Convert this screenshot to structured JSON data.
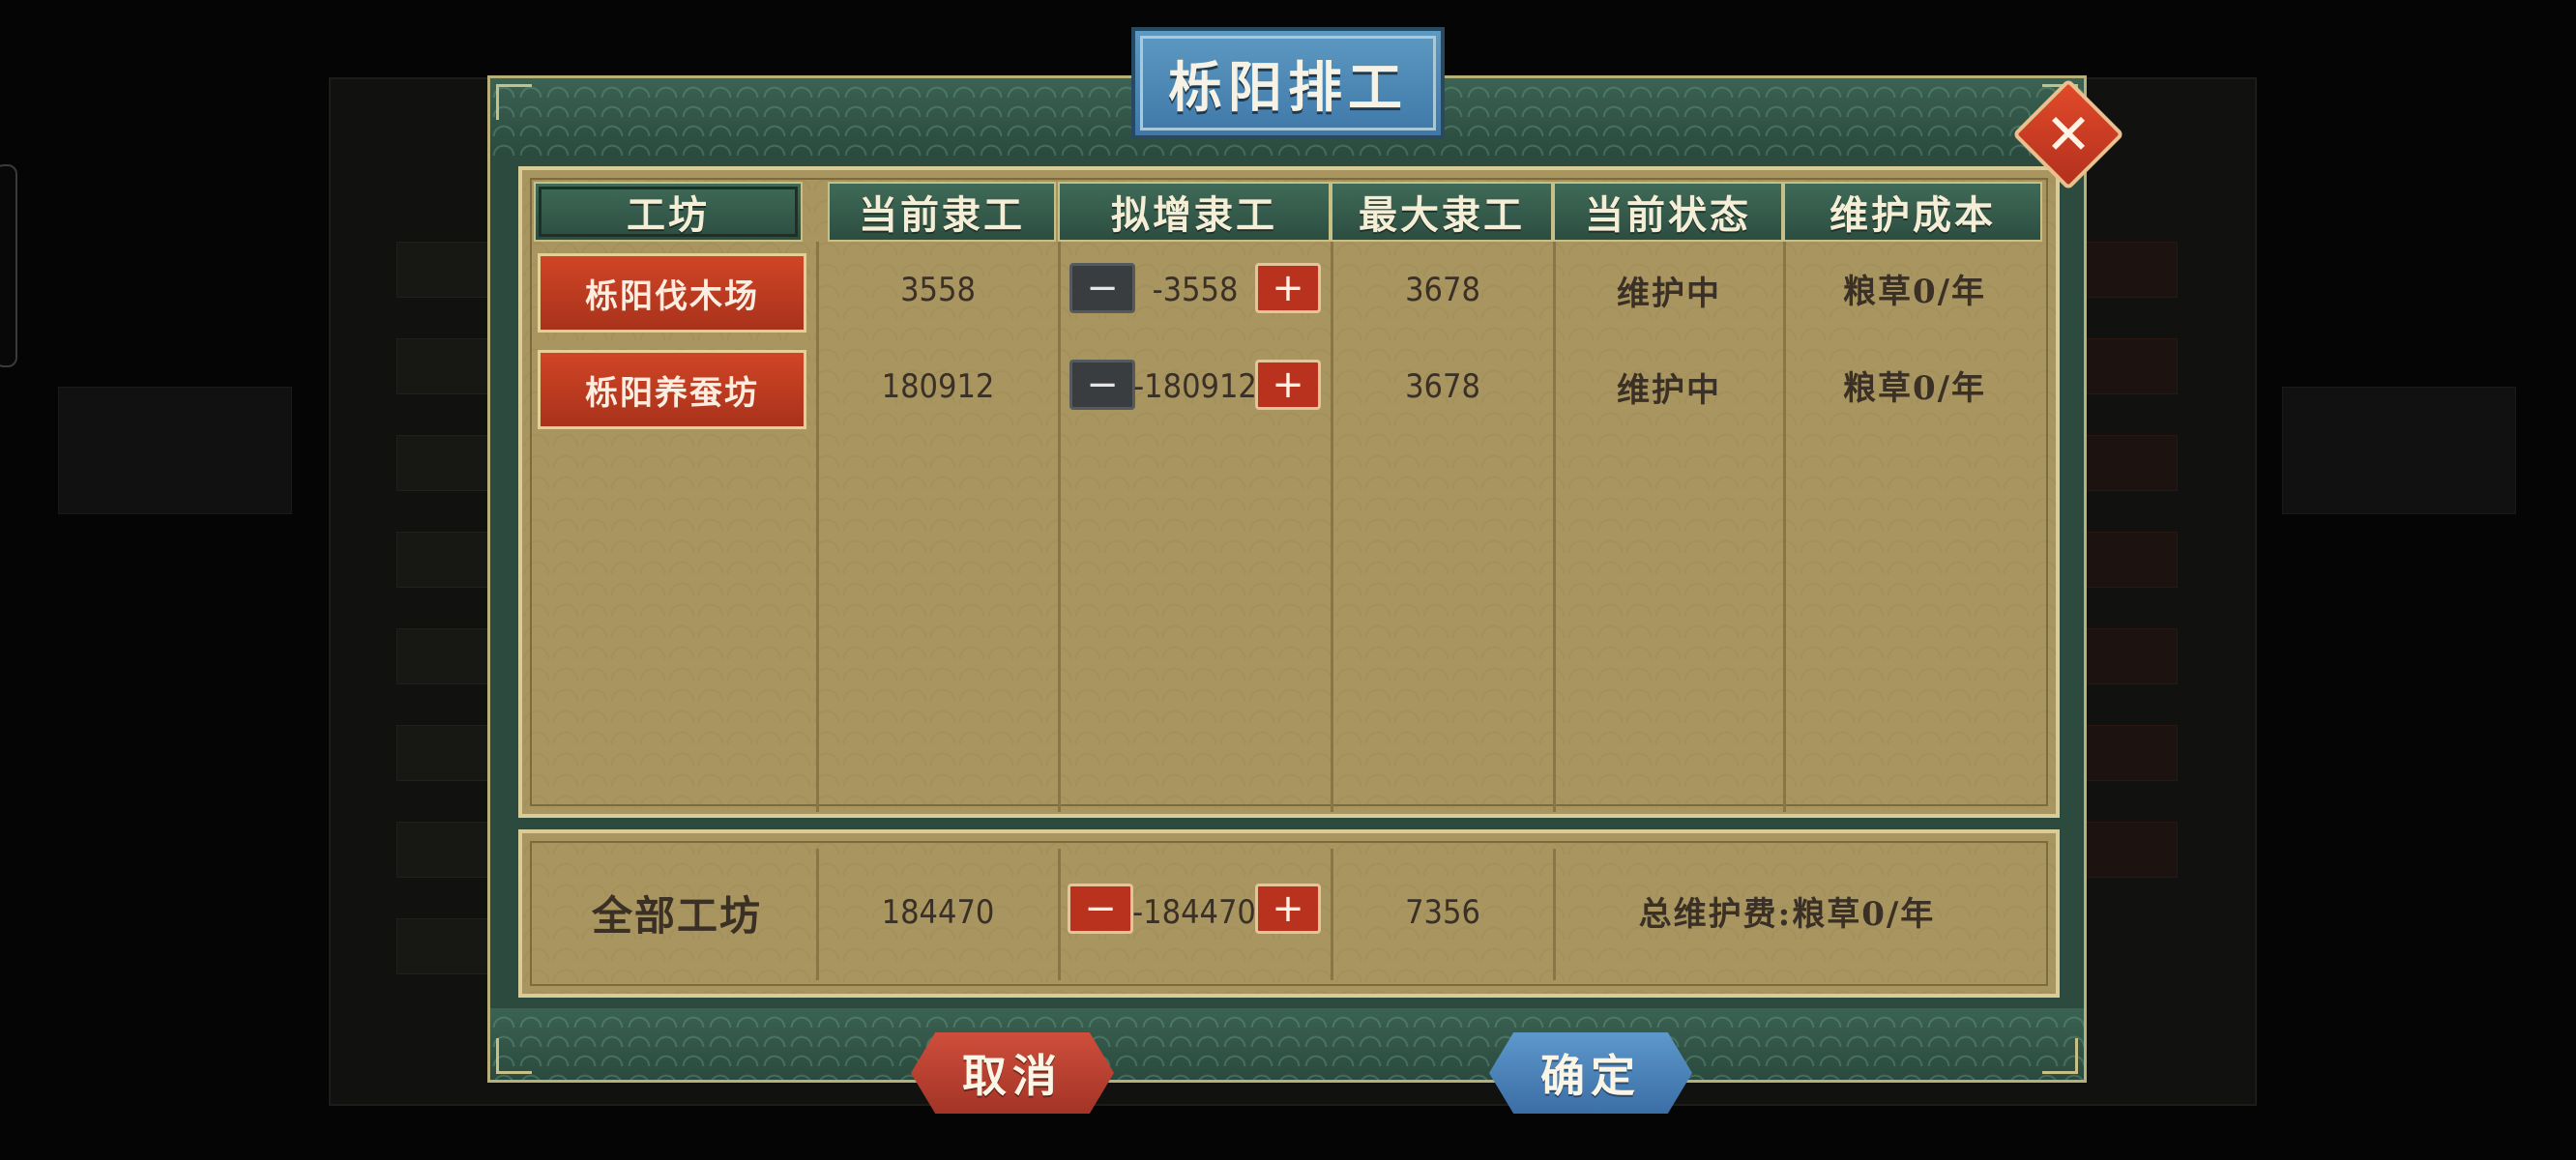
{
  "dialog": {
    "title": "栎阳排工",
    "close_symbol": "✕"
  },
  "table": {
    "headers": [
      "工坊",
      "当前隶工",
      "拟增隶工",
      "最大隶工",
      "当前状态",
      "维护成本"
    ],
    "rows": [
      {
        "workshop": "栎阳伐木场",
        "current": "3558",
        "delta": "-3558",
        "max": "3678",
        "status": "维护中",
        "cost": "粮草0/年"
      },
      {
        "workshop": "栎阳养蚕坊",
        "current": "180912",
        "delta": "-180912",
        "max": "3678",
        "status": "维护中",
        "cost": "粮草0/年"
      }
    ],
    "stepper": {
      "minus": "−",
      "plus": "+"
    }
  },
  "totals": {
    "label": "全部工坊",
    "current": "184470",
    "delta": "-184470",
    "max": "7356",
    "total_cost": "总维护费:粮草0/年"
  },
  "buttons": {
    "cancel": "取消",
    "confirm": "确定"
  },
  "colors": {
    "frame_green": "#2c4a3e",
    "parchment": "#a8955f",
    "accent_red": "#b8321e",
    "accent_blue": "#3f78a8"
  }
}
